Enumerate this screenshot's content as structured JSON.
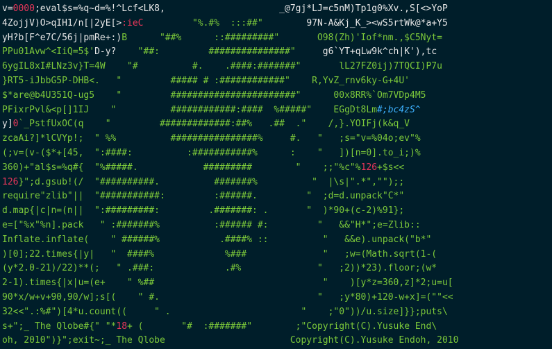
{
  "colors": {
    "background": "#001e2a",
    "default": "#e8e8e8",
    "green": "#7cc93a",
    "red": "#e8375a",
    "blue": "#3db1ff"
  },
  "lines": [
    [
      {
        "c": "default",
        "t": "v="
      },
      {
        "c": "red",
        "t": "0000"
      },
      {
        "c": "default",
        "t": ";eval$s=%q~d=%!^Lcf<LK8,                     _@7gj*LJ=c5nM)Tp1g0%Xv.,S[<>YoP"
      }
    ],
    [
      {
        "c": "default",
        "t": "4ZojjV)O>qIH1/n[|2yE[>"
      },
      {
        "c": "red",
        "t": ":ieC"
      },
      {
        "c": "green",
        "t": "         \"%.#%  :::##\"        "
      },
      {
        "c": "default",
        "t": "97N-A&Kj_K_><wS5rtWk@*a+Y5"
      }
    ],
    [
      {
        "c": "default",
        "t": "yH?b[F^e7C/56j|pmRe+:)"
      },
      {
        "c": "green",
        "t": "B      \"##%      ::#########\"       O98(Zh)'Iof*nm.,$C5Nyt="
      }
    ],
    [
      {
        "c": "green",
        "t": "PPu01Avw^<IiQ=5$'"
      },
      {
        "c": "default",
        "t": "D-y?"
      },
      {
        "c": "green",
        "t": "    \"##:         ###############\"     "
      },
      {
        "c": "default",
        "t": "g6`YT+qLw9k^ch|K'),tc"
      }
    ],
    [
      {
        "c": "green",
        "t": "6ygIL8xI#LNz3v}T=4W    \"#          #.    .####:#######\"       lL27FZ0ij)7TQCI)P7u"
      }
    ],
    [
      {
        "c": "green",
        "t": "}RT5-iJbbG5P-DHB<.   \"         ##### # :############\"    R,YvZ_rnv6ky-G+4U'"
      }
    ],
    [
      {
        "c": "green",
        "t": "$*are@b4U351Q-ug5    \"         #######################\"      00x8RR%`Om7VDp4M5"
      }
    ],
    [
      {
        "c": "green",
        "t": "PFixrPvl&<p[]1IJ    \"          ############:####  %#####\"    EGgDt8Lm"
      },
      {
        "c": "blue",
        "t": "#;bc4zS^"
      }
    ],
    [
      {
        "c": "default",
        "t": "y]"
      },
      {
        "c": "red",
        "t": "0"
      },
      {
        "c": "green",
        "t": "`_PstfUxOC(q    \"         #############:##%   .##  .\"    /,}.YOIFj(k&q_V"
      }
    ],
    [
      {
        "c": "green",
        "t": "zcaAi?]*lCVYp!;  \" %%          ################%     #.   \"   ;s=\"v=%04o;ev\"%"
      }
    ],
    [
      {
        "c": "green",
        "t": "(;v=(v-($*+[45,  \":####:          :###########%      :    \"   ])[n=0].to_i;)%"
      }
    ],
    [
      {
        "c": "green",
        "t": "360)+\"al$s=%q#{  \"%#####.            #########        \"    ;;\"%c\"%"
      },
      {
        "c": "red",
        "t": "126"
      },
      {
        "c": "green",
        "t": "+$s<<"
      }
    ],
    [
      {
        "c": "red",
        "t": "126"
      },
      {
        "c": "green",
        "t": "}\";d.gsub!(/  \"##########.          #######%          \"  |\\s|\".*\",\"\");;"
      }
    ],
    [
      {
        "c": "green",
        "t": "require\"zlib\"||  \"###########:         :######.         \"  ;d=d.unpack\"C*\""
      }
    ],
    [
      {
        "c": "green",
        "t": "d.map{|c|n=(n||  \":#########:         .#######: .       \"  )*90+(c-2)%91};"
      }
    ],
    [
      {
        "c": "green",
        "t": "e=[\"%x\"%n].pack   \" :#######%          :###### #:         \"   &&\"H*\";e=Zlib::"
      }
    ],
    [
      {
        "c": "green",
        "t": "Inflate.inflate(    \" ######%           .####% ::          \"   &&e).unpack(\"b*\""
      }
    ],
    [
      {
        "c": "green",
        "t": ")[0];22.times{|y|   \"  ####%             %###              \"   ;w=(Math.sqrt(1-("
      }
    ],
    [
      {
        "c": "green",
        "t": "(y*2.0-21)/22)**(;   \" .###:             .#%              \"   ;2))*23).floor;(w*"
      }
    ],
    [
      {
        "c": "green",
        "t": "2-1).times{|x|u=(e+    \" %##                               \"    )[y*z=360,z]*2;u=u["
      }
    ],
    [
      {
        "c": "green",
        "t": "90*x/w+v+90,90/w];s[(    \" #.                             \"   ;y*80)+120-w+x]=(\"\"<<"
      }
    ],
    [
      {
        "c": "green",
        "t": "32<<\".:%#\")[4*u.count((     \" .                        \"    ;\"0\"))/u.size]}};puts\\"
      }
    ],
    [
      {
        "c": "green",
        "t": "s+\";_ The Qlobe#{\" \"*"
      },
      {
        "c": "red",
        "t": "18"
      },
      {
        "c": "green",
        "t": "+ (       \"#  :#######\"        ;\"Copyright(C).Yusuke End\\"
      }
    ],
    [
      {
        "c": "green",
        "t": "oh, 2010\")}\";exit~;_ The Qlobe                       Copyright(C).Yusuke Endoh, 2010"
      }
    ]
  ]
}
